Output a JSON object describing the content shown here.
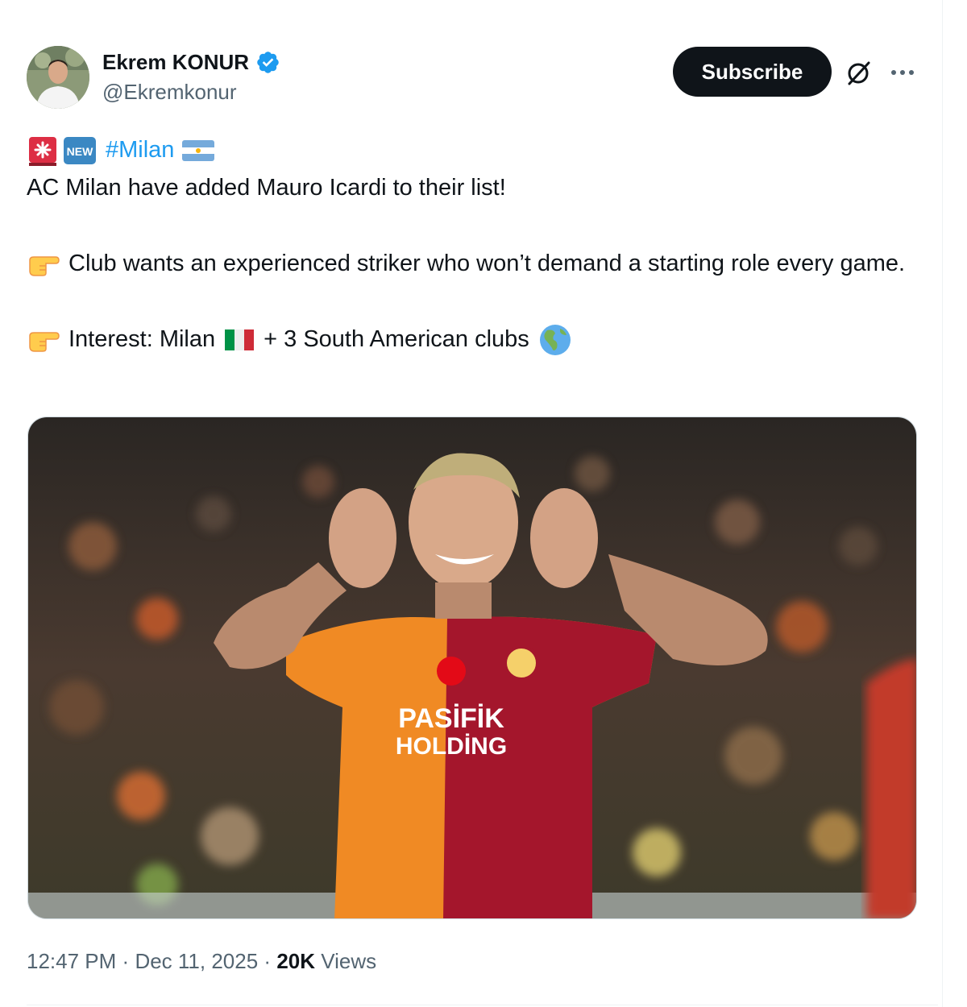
{
  "author": {
    "display_name": "Ekrem KONUR",
    "handle": "@Ekremkonur",
    "verified": true,
    "avatar_icon": "profile-photo"
  },
  "actions": {
    "subscribe_label": "Subscribe",
    "grok_icon": "slashed-circle-icon",
    "more_icon": "more-dots-icon"
  },
  "tweet": {
    "line1_emojis": [
      "siren-icon",
      "new-badge-icon"
    ],
    "hashtag": "#Milan",
    "hashtag_flag": "argentina-flag-icon",
    "line2": "AC Milan have added Mauro Icardi to their list!",
    "line3_icon": "point-right-icon",
    "line3": "Club wants an experienced striker who won’t demand a starting role every game.",
    "line4_icon": "point-right-icon",
    "line4_a": "Interest: Milan",
    "line4_flag": "italy-flag-icon",
    "line4_b": "+ 3 South American clubs",
    "line4_globe": "globe-americas-icon"
  },
  "media": {
    "jersey_sponsor_line1": "PASİFİK",
    "jersey_sponsor_line2": "HOLDİNG"
  },
  "meta": {
    "time": "12:47 PM",
    "separator": "·",
    "date": "Dec 11, 2025",
    "views_count": "20K",
    "views_label": "Views"
  },
  "colors": {
    "link": "#1d9bf0",
    "text": "#0f1419",
    "secondary": "#536471",
    "button_bg": "#0f1419",
    "jersey_red": "#a4162c",
    "jersey_orange": "#f08a24"
  }
}
